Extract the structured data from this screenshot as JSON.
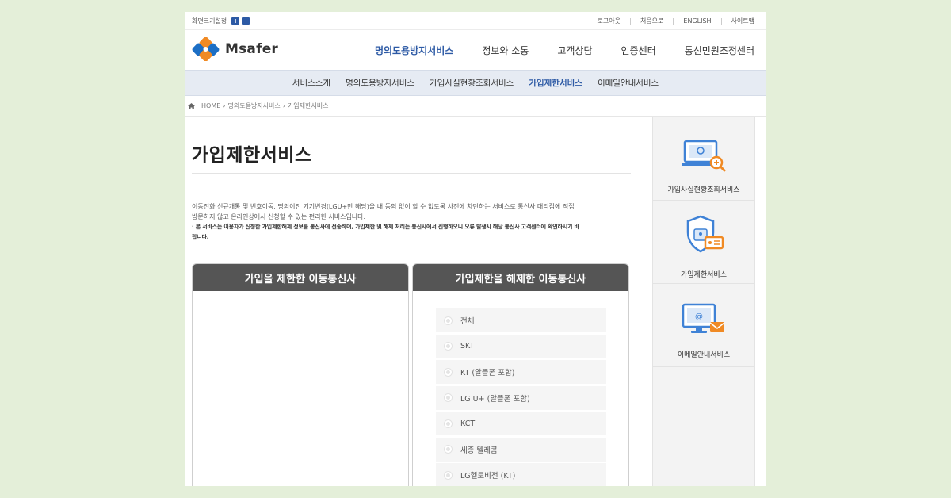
{
  "util": {
    "zoom_label": "화면크기설정",
    "zoom_in": "+",
    "zoom_out": "−",
    "links": [
      "로그아웃",
      "처음으로",
      "ENGLISH",
      "사이트맵"
    ]
  },
  "header": {
    "logo_text": "Msafer",
    "gnb": [
      "명의도용방지서비스",
      "정보와 소통",
      "고객상담",
      "인증센터",
      "통신민원조정센터"
    ],
    "gnb_active": 0
  },
  "subnav": {
    "items": [
      "서비스소개",
      "명의도용방지서비스",
      "가입사실현황조회서비스",
      "가입제한서비스",
      "이메일안내서비스"
    ],
    "active": 3
  },
  "breadcrumb": {
    "home": "HOME",
    "items": [
      "명의도용방지서비스",
      "가입제한서비스"
    ]
  },
  "main": {
    "title": "가입제한서비스",
    "desc_line1": "이동전화 신규개통 및 번호이동, 명의이전 기기변경(LGU+만 해당)을 내 동의 없이 할 수 없도록 사전에 차단하는 서비스로 통신사 대리점에 직접",
    "desc_line2": "방문하지 않고 온라인상에서 신청할 수 있는 편리한 서비스입니다.",
    "note_line1": "· 본 서비스는 이용자가 신청한 가입제한해제 정보를 통신사에 전송하며, 가입제한 및 해제 처리는 통신사에서 진행하오니 오류 발생시 해당 통신사 고객센터에 확인하시기 바",
    "note_line2": "랍니다.",
    "left_box_title": "가입을 제한한 이동통신사",
    "right_box_title": "가입제한을 해제한 이동통신사",
    "carriers": [
      "전체",
      "SKT",
      "KT (알뜰폰 포함)",
      "LG U+ (알뜰폰 포함)",
      "KCT",
      "세종 텔레콤",
      "LG헬로비전 (KT)"
    ]
  },
  "side": {
    "items": [
      "가입사실현황조회서비스",
      "가입제한서비스",
      "이메일안내서비스"
    ]
  },
  "colors": {
    "accent": "#2d5aa5",
    "icon_blue": "#3f82d6",
    "icon_orange": "#f08a24",
    "box_header": "#555555",
    "background": "#e4efd9"
  }
}
